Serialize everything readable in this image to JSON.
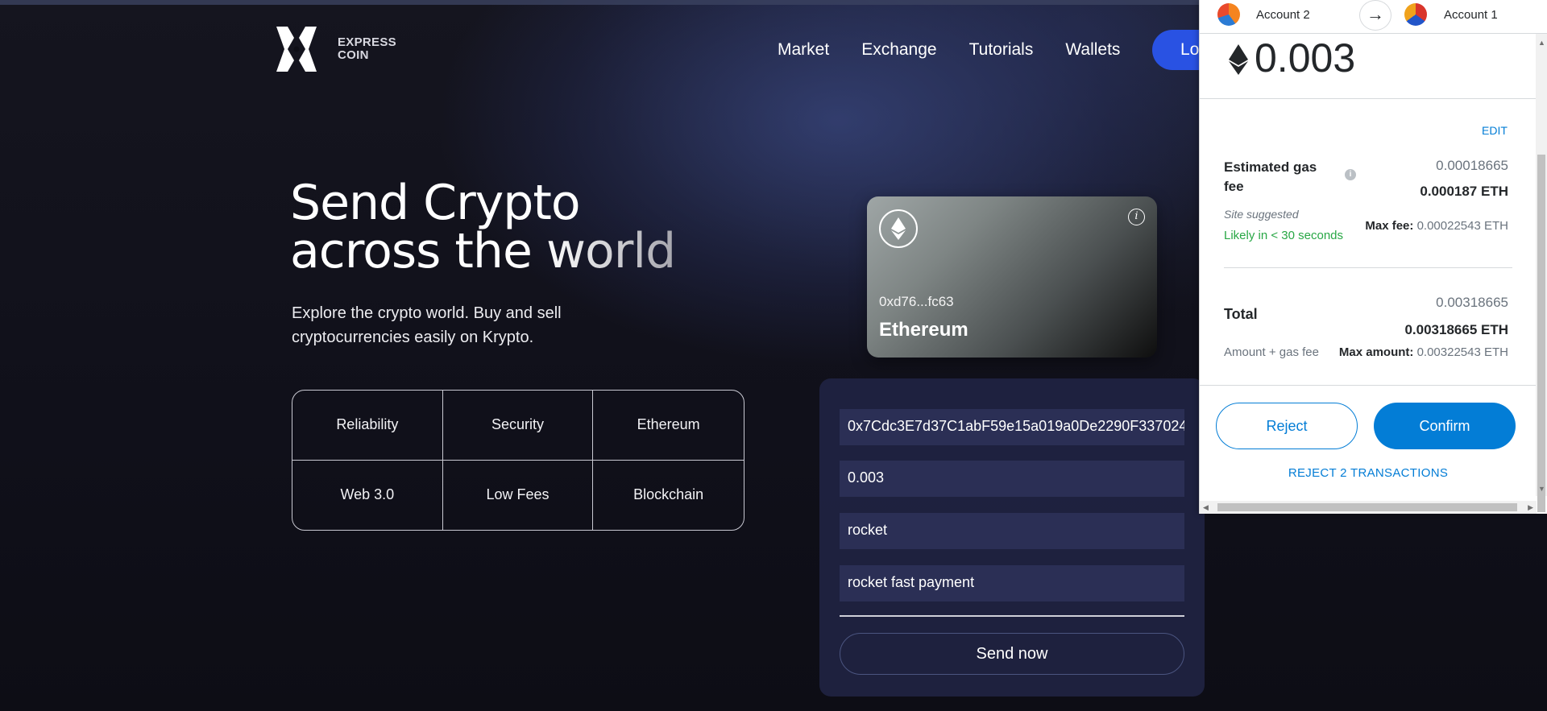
{
  "header": {
    "logo_line1": "EXPRESS",
    "logo_line2": "COIN",
    "nav": [
      "Market",
      "Exchange",
      "Tutorials",
      "Wallets"
    ],
    "login_label": "Lo"
  },
  "hero": {
    "title_line1": "Send Crypto",
    "title_line2_a": "across ",
    "title_line2_b": "the world",
    "subtitle_line1": "Explore the crypto world. Buy and sell",
    "subtitle_line2": "cryptocurrencies easily on Krypto."
  },
  "features": [
    "Reliability",
    "Security",
    "Ethereum",
    "Web 3.0",
    "Low Fees",
    "Blockchain"
  ],
  "eth_card": {
    "address": "0xd76...fc63",
    "network": "Ethereum",
    "icon": "ethereum-icon"
  },
  "form": {
    "address_value": "0x7Cdc3E7d37C1abF59e15a019a0De2290F337024",
    "amount_value": "0.003",
    "keyword_value": "rocket",
    "message_value": "rocket fast payment",
    "send_label": "Send now"
  },
  "wallet": {
    "from_account": "Account 2",
    "to_account": "Account 1",
    "amount": "0.003",
    "edit_label": "EDIT",
    "gas_label": "Estimated gas fee",
    "gas_small": "0.00018665",
    "gas_big": "0.000187 ETH",
    "site_suggested": "Site suggested",
    "likely": "Likely in < 30 seconds",
    "max_fee_label": "Max fee:",
    "max_fee_value": "0.00022543 ETH",
    "total_label": "Total",
    "total_small": "0.00318665",
    "total_big": "0.00318665 ETH",
    "amount_gas_label": "Amount + gas fee",
    "max_amount_label": "Max amount:",
    "max_amount_value": "0.00322543 ETH",
    "reject_label": "Reject",
    "confirm_label": "Confirm",
    "reject_all_label": "REJECT 2 TRANSACTIONS",
    "colors": {
      "accent": "#037dd6",
      "success": "#28a745",
      "brand_button": "#2952e3"
    }
  }
}
